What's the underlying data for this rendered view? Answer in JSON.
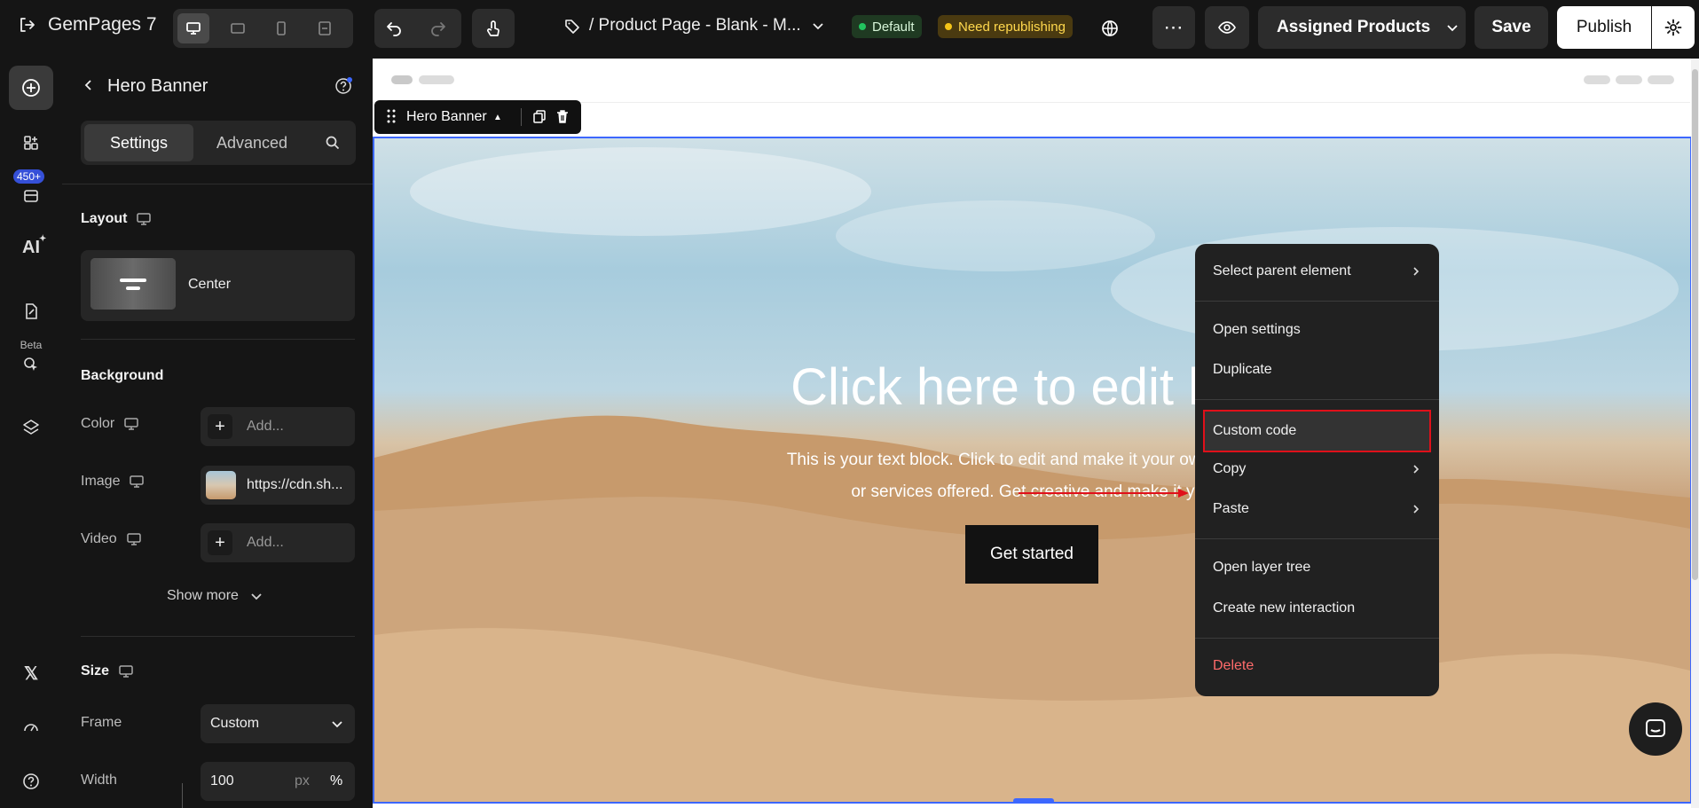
{
  "app": {
    "name": "GemPages 7"
  },
  "topbar": {
    "page_title": "/ Product Page - Blank - M...",
    "badge_default": "Default",
    "badge_republish": "Need republishing",
    "assigned_products": "Assigned Products",
    "save": "Save",
    "publish": "Publish",
    "colors": {
      "default_dot": "#22c55e",
      "republish_dot": "#f5c518"
    }
  },
  "rail": {
    "count_badge": "450+",
    "ai_label": "AI",
    "beta_label": "Beta"
  },
  "panel": {
    "title": "Hero Banner",
    "tabs": {
      "settings": "Settings",
      "advanced": "Advanced"
    },
    "layout": {
      "heading": "Layout",
      "value": "Center"
    },
    "background": {
      "heading": "Background",
      "color_label": "Color",
      "color_value": "Add...",
      "image_label": "Image",
      "image_value": "https://cdn.sh...",
      "video_label": "Video",
      "video_value": "Add..."
    },
    "show_more": "Show more",
    "size": {
      "heading": "Size",
      "frame_label": "Frame",
      "frame_value": "Custom",
      "width_label": "Width",
      "width_value": "100",
      "unit_px": "px",
      "unit_pct": "%"
    }
  },
  "canvas": {
    "toolbar_label": "Hero Banner",
    "hero": {
      "heading": "Click here to edit hea",
      "text_line1": "This is your text block. Click to edit and make it your own. Share y",
      "text_line2": "or services offered. Get creative and make it you",
      "button": "Get started"
    }
  },
  "context_menu": {
    "items": [
      "Select parent element",
      "Open settings",
      "Duplicate",
      "Custom code",
      "Copy",
      "Paste",
      "Open layer tree",
      "Create new interaction",
      "Delete"
    ],
    "highlighted": "Custom code",
    "colors": {
      "delete": "#ff6b6b",
      "highlight_border": "#e0101a"
    }
  }
}
